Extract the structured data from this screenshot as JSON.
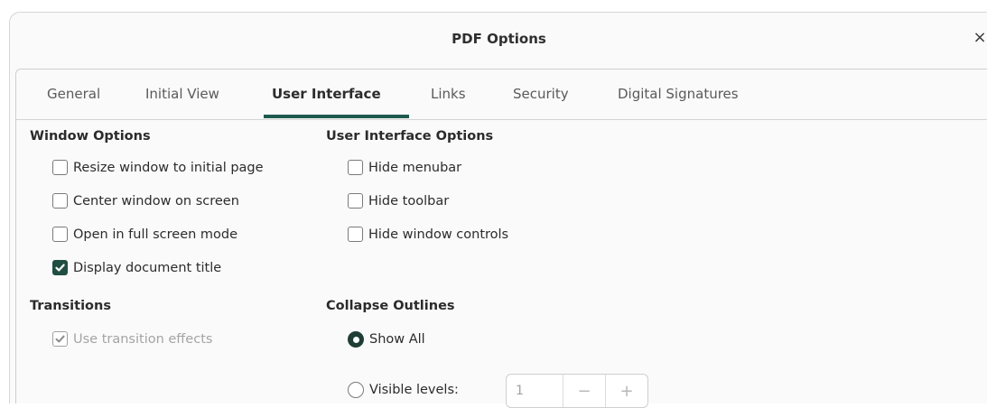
{
  "window": {
    "title": "PDF Options",
    "close_symbol": "×"
  },
  "tabs": [
    {
      "label": "General"
    },
    {
      "label": "Initial View"
    },
    {
      "label": "User Interface",
      "active": true
    },
    {
      "label": "Links"
    },
    {
      "label": "Security"
    },
    {
      "label": "Digital Signatures"
    }
  ],
  "window_options": {
    "title": "Window Options",
    "items": [
      {
        "label": "Resize window to initial page",
        "checked": false
      },
      {
        "label": "Center window on screen",
        "checked": false
      },
      {
        "label": "Open in full screen mode",
        "checked": false
      },
      {
        "label": "Display document title",
        "checked": true
      }
    ]
  },
  "ui_options": {
    "title": "User Interface Options",
    "items": [
      {
        "label": "Hide menubar",
        "checked": false
      },
      {
        "label": "Hide toolbar",
        "checked": false
      },
      {
        "label": "Hide window controls",
        "checked": false
      }
    ]
  },
  "transitions": {
    "title": "Transitions",
    "use_effects": {
      "label": "Use transition effects",
      "checked": true,
      "disabled": true
    }
  },
  "collapse_outlines": {
    "title": "Collapse Outlines",
    "show_all": {
      "label": "Show All",
      "selected": true
    },
    "visible_levels": {
      "label": "Visible levels:",
      "selected": false,
      "value": "1",
      "minus": "−",
      "plus": "+"
    }
  },
  "colors": {
    "accent": "#214e42",
    "tab_underline": "#1e5a4e"
  }
}
